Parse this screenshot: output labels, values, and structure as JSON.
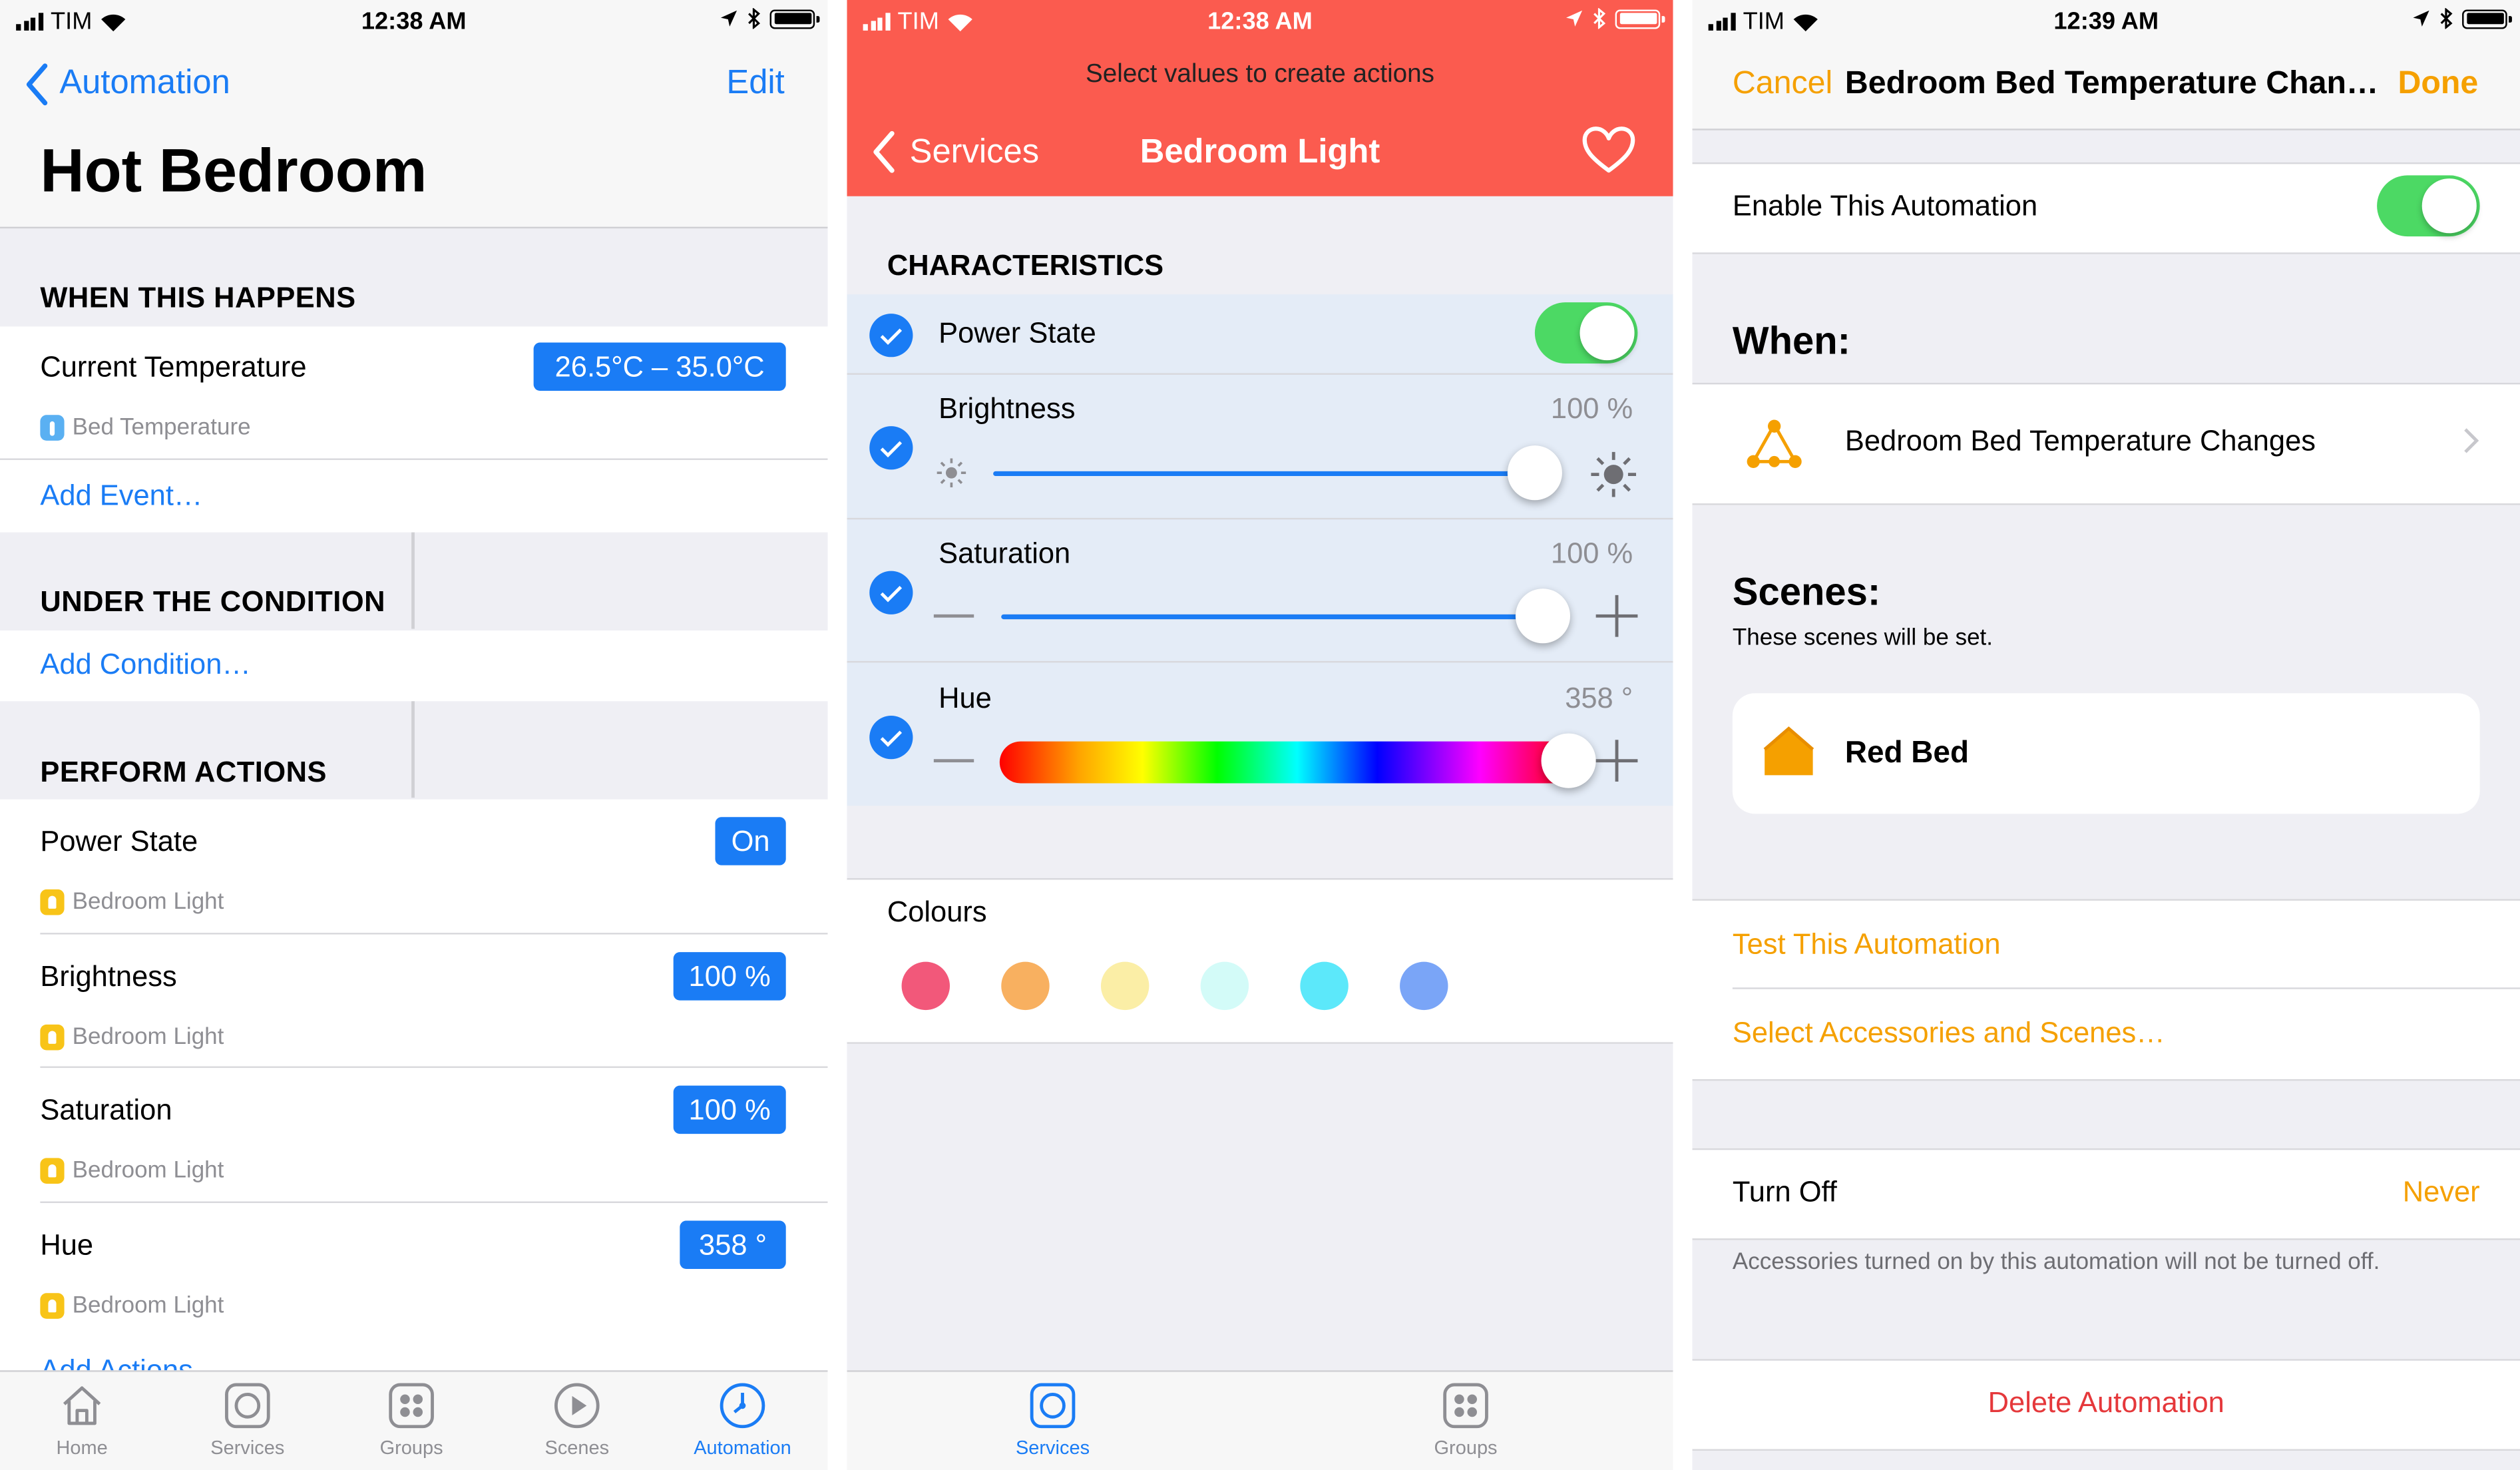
{
  "status_left": {
    "carrier": "TIM",
    "time": "12:38 AM"
  },
  "status_mid": {
    "carrier": "TIM",
    "time": "12:38 AM"
  },
  "status_right": {
    "carrier": "TIM",
    "time": "12:39 AM"
  },
  "left": {
    "back_label": "Automation",
    "edit_label": "Edit",
    "title": "Hot Bedroom",
    "sections": {
      "when": "WHEN THIS HAPPENS",
      "condition": "UNDER THE CONDITION",
      "actions": "PERFORM ACTIONS"
    },
    "event": {
      "title": "Current Temperature",
      "value": "26.5°C – 35.0°C",
      "accessory": "Bed Temperature"
    },
    "add_event": "Add Event…",
    "add_condition": "Add Condition…",
    "actions": [
      {
        "title": "Power State",
        "value": "On",
        "accessory": "Bedroom Light"
      },
      {
        "title": "Brightness",
        "value": "100 %",
        "accessory": "Bedroom Light"
      },
      {
        "title": "Saturation",
        "value": "100 %",
        "accessory": "Bedroom Light"
      },
      {
        "title": "Hue",
        "value": "358 °",
        "accessory": "Bedroom Light"
      }
    ],
    "add_actions": "Add Actions…",
    "tabs": [
      {
        "label": "Home",
        "icon": "home-icon"
      },
      {
        "label": "Services",
        "icon": "services-icon"
      },
      {
        "label": "Groups",
        "icon": "groups-icon"
      },
      {
        "label": "Scenes",
        "icon": "scenes-icon"
      },
      {
        "label": "Automation",
        "icon": "automation-icon"
      }
    ],
    "active_tab": "Automation"
  },
  "middle": {
    "banner": "Select values to create actions",
    "back_label": "Services",
    "title": "Bedroom Light",
    "header_color": "#fb5b4f",
    "section": "CHARACTERISTICS",
    "power": {
      "label": "Power State",
      "on": true
    },
    "brightness": {
      "label": "Brightness",
      "value": "100 %",
      "level": 1.0
    },
    "saturation": {
      "label": "Saturation",
      "value": "100 %",
      "level": 1.0
    },
    "hue": {
      "label": "Hue",
      "value": "358 °",
      "level": 0.994
    },
    "colours_label": "Colours",
    "colours": [
      "#f2587a",
      "#f8b060",
      "#fbeea6",
      "#d3fbf8",
      "#5ce8fa",
      "#7aa5f7"
    ],
    "tabs": [
      {
        "label": "Services",
        "icon": "services-icon"
      },
      {
        "label": "Groups",
        "icon": "groups-icon"
      }
    ],
    "active_tab": "Services"
  },
  "right": {
    "cancel_label": "Cancel",
    "title": "Bedroom Bed Temperature Chan…",
    "done_label": "Done",
    "enable_label": "Enable This Automation",
    "enabled": true,
    "when_heading": "When:",
    "trigger": "Bedroom Bed Temperature Changes",
    "scenes_heading": "Scenes:",
    "scenes_sub": "These scenes will be set.",
    "scene_name": "Red Bed",
    "test_label": "Test This Automation",
    "select_label": "Select Accessories and Scenes…",
    "turn_off_label": "Turn Off",
    "turn_off_value": "Never",
    "turn_off_note": "Accessories turned on by this automation will not be turned off.",
    "delete_label": "Delete Automation",
    "accent": "#f5a000",
    "danger": "#e5383b"
  }
}
